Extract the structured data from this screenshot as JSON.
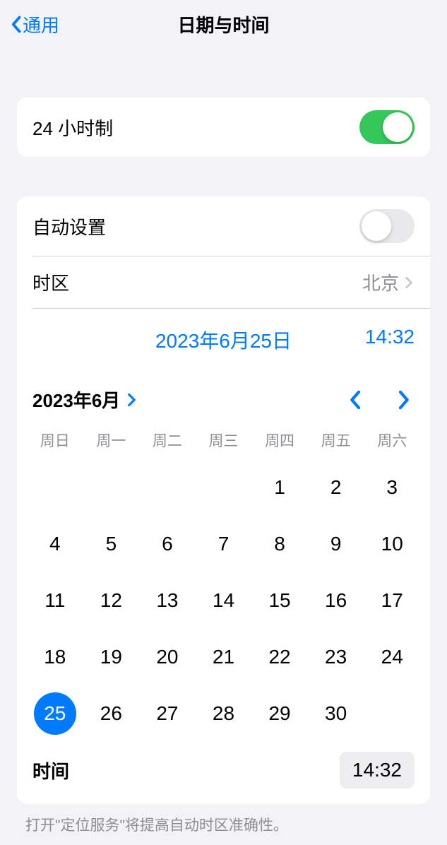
{
  "header": {
    "back_label": "通用",
    "title": "日期与时间"
  },
  "twenty_four_hour": {
    "label": "24 小时制",
    "enabled": true
  },
  "auto_set": {
    "label": "自动设置",
    "enabled": false
  },
  "timezone": {
    "label": "时区",
    "value": "北京"
  },
  "selected": {
    "date_display": "2023年6月25日",
    "time_display": "14:32"
  },
  "calendar": {
    "month_year": "2023年6月",
    "weekdays": [
      "周日",
      "周一",
      "周二",
      "周三",
      "周四",
      "周五",
      "周六"
    ],
    "first_weekday_index": 4,
    "days_in_month": 30,
    "selected_day": 25,
    "time_label": "时间",
    "time_value": "14:32"
  },
  "footer_note": "打开\"定位服务\"将提高自动时区准确性。"
}
